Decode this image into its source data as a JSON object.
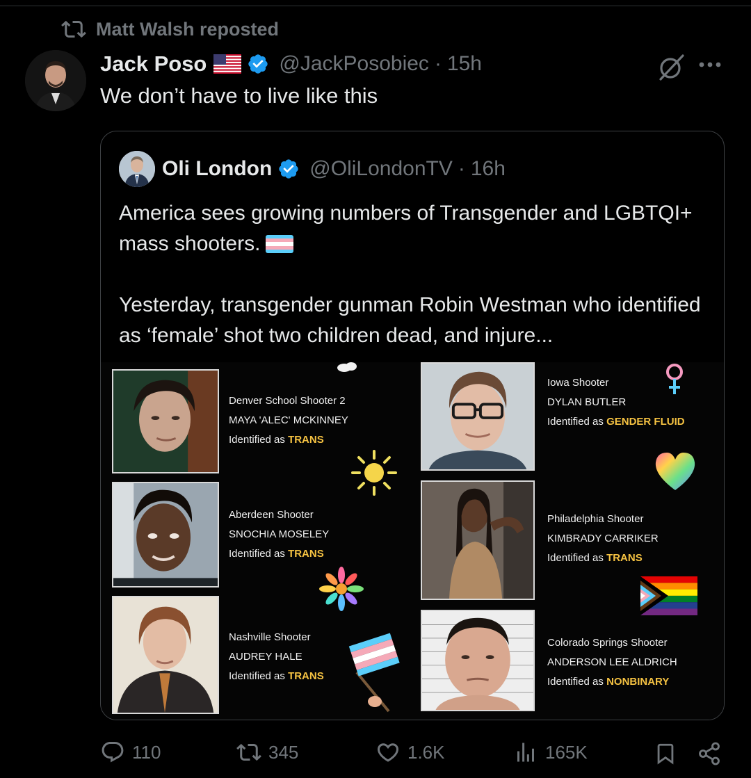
{
  "repost": {
    "text": "Matt Walsh reposted",
    "icon": "repost-icon"
  },
  "tweet": {
    "author_name": "Jack Poso",
    "handle": "@JackPosobiec",
    "separator": "·",
    "time": "15h",
    "text": "We don’t have to live like this"
  },
  "quote": {
    "author_name": "Oli London",
    "handle": "@OliLondonTV",
    "separator": "·",
    "time": "16h",
    "text_1": "America sees growing numbers of Transgender and LGBTQI+ mass shooters.",
    "text_2": "Yesterday, transgender gunman Robin Westman who identified as ‘female’ shot two children dead, and injure..."
  },
  "collage": {
    "entries": [
      {
        "title": "Denver School Shooter 2",
        "name": "MAYA 'ALEC' MCKINNEY",
        "ident_prefix": "Identified as ",
        "ident": "TRANS"
      },
      {
        "title": "Aberdeen Shooter",
        "name": "SNOCHIA MOSELEY",
        "ident_prefix": "Identified as ",
        "ident": "TRANS"
      },
      {
        "title": "Nashville Shooter",
        "name": "AUDREY HALE",
        "ident_prefix": "Identified as ",
        "ident": "TRANS"
      },
      {
        "title": "Iowa Shooter",
        "name": "DYLAN BUTLER",
        "ident_prefix": "Identified as ",
        "ident": "GENDER FLUID"
      },
      {
        "title": "Philadelphia Shooter",
        "name": "KIMBRADY CARRIKER",
        "ident_prefix": "Identified as ",
        "ident": "TRANS"
      },
      {
        "title": "Colorado Springs Shooter",
        "name": "ANDERSON LEE ALDRICH",
        "ident_prefix": "Identified as ",
        "ident": "NONBINARY"
      }
    ]
  },
  "actions": {
    "replies": "110",
    "reposts": "345",
    "likes": "1.6K",
    "views": "165K"
  },
  "colors": {
    "background": "#000000",
    "text": "#e7e9ea",
    "muted": "#71767b",
    "verified": "#1d9bf0",
    "highlight": "#f5c242",
    "border": "#3e4144"
  }
}
